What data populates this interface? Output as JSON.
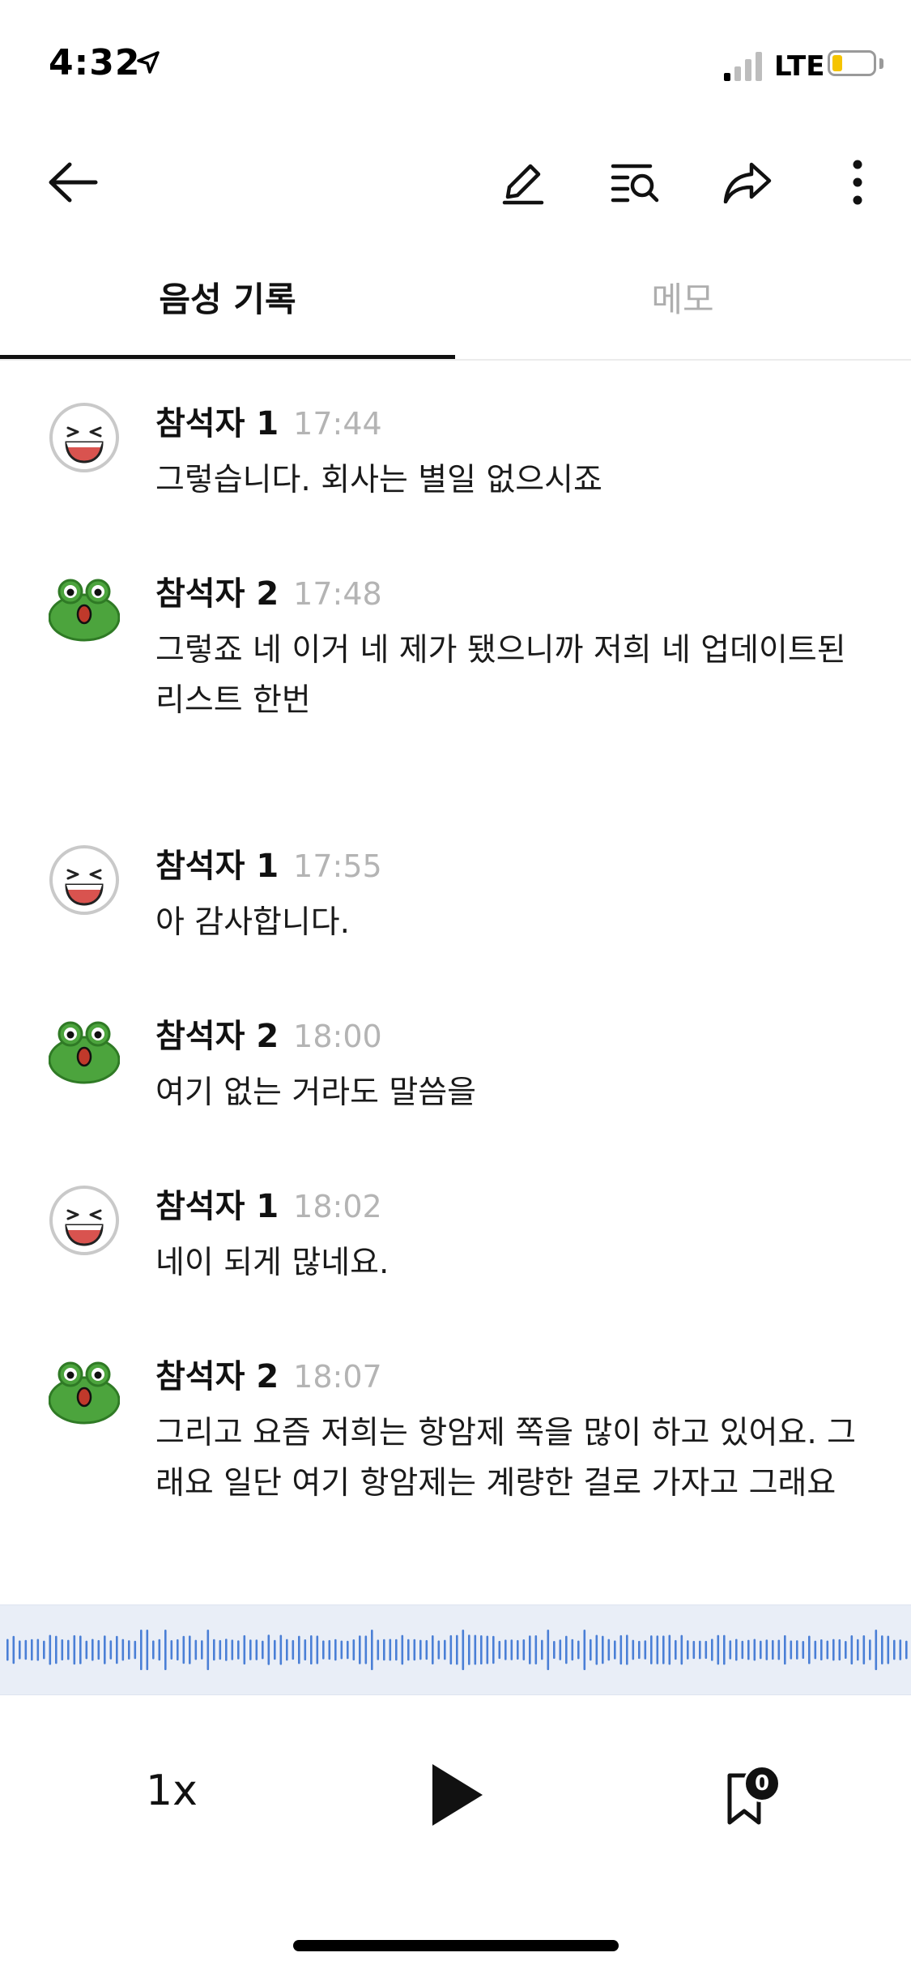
{
  "status_bar": {
    "time": "4:32",
    "network": "LTE",
    "battery_level": 0.2,
    "signal_bars": 1
  },
  "toolbar": {
    "back_icon": "arrow-left-icon",
    "edit_icon": "pencil-icon",
    "search_list_icon": "list-search-icon",
    "share_icon": "share-arrow-icon",
    "more_icon": "more-vertical-icon"
  },
  "tabs": [
    {
      "label": "음성 기록",
      "active": true
    },
    {
      "label": "메모",
      "active": false
    }
  ],
  "messages": [
    {
      "speaker": "참석자 1",
      "time": "17:44",
      "avatar": "laughing-face-icon",
      "text": "그렇습니다. 회사는 별일 없으시죠"
    },
    {
      "speaker": "참석자 2",
      "time": "17:48",
      "avatar": "frog-icon",
      "text": "그렇죠 네 이거 네 제가 됐으니까 저희 네 업데이트된 리스트 한번"
    },
    {
      "speaker": "참석자 1",
      "time": "17:55",
      "avatar": "laughing-face-icon",
      "text": "아 감사합니다."
    },
    {
      "speaker": "참석자 2",
      "time": "18:00",
      "avatar": "frog-icon",
      "text": "여기 없는 거라도 말씀을"
    },
    {
      "speaker": "참석자 1",
      "time": "18:02",
      "avatar": "laughing-face-icon",
      "text": "네이 되게 많네요."
    },
    {
      "speaker": "참석자 2",
      "time": "18:07",
      "avatar": "frog-icon",
      "text": "그리고 요즘 저희는 항암제 쪽을 많이 하고 있어요. 그래요 일단 여기 항암제는 계량한 걸로 가자고 그래요"
    }
  ],
  "player": {
    "speed": "1x",
    "play_icon": "play-icon",
    "bookmark_icon": "bookmark-icon",
    "bookmark_count": "0",
    "waveform_color": "#4a7fd6"
  }
}
